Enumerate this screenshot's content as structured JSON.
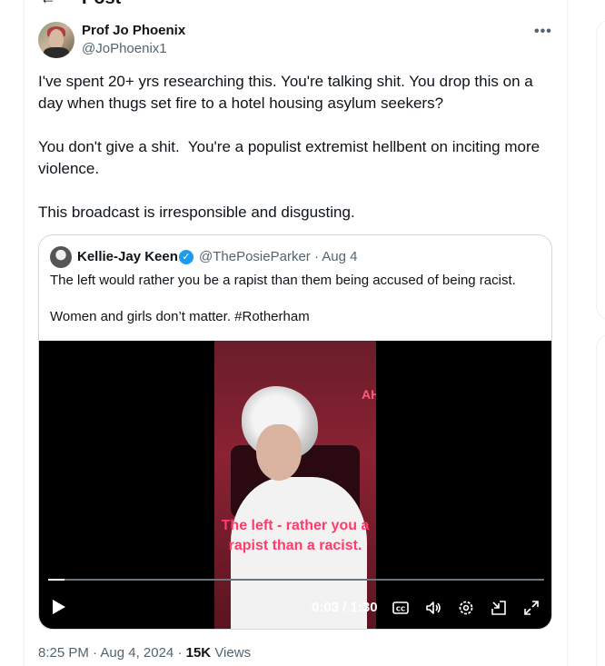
{
  "header": {
    "title": "Post"
  },
  "post": {
    "author_name": "Prof Jo Phoenix",
    "author_handle": "@JoPhoenix1",
    "paragraphs": [
      "I've spent 20+ yrs researching this. You're talking shit. You drop this on a day when thugs set fire to a hotel housing asylum seekers?",
      "You don't give a shit.  You're a populist extremist hellbent on inciting more violence.",
      "This broadcast is irresponsible and disgusting."
    ],
    "timestamp": "8:25 PM · Aug 4, 2024",
    "dot": " · ",
    "views_count": "15K",
    "views_label": " Views"
  },
  "quote": {
    "author_name": "Kellie-Jay Keen",
    "author_handle": "@ThePosieParker · Aug 4",
    "paragraphs": [
      "The left would rather you be a rapist than them being accused of being racist.",
      "Women and girls don’t matter.  #Rotherham"
    ],
    "video": {
      "neon_text": "AHF",
      "caption_line1": "The left - rather you a",
      "caption_line2": "rapist than a racist.",
      "time_display": "0:03 / 1:30",
      "progress": 0.033
    }
  },
  "colors": {
    "text_primary": "#0f1419",
    "text_secondary": "#536471",
    "verified_blue": "#1d9bf0",
    "caption_pink": "#ff3b6b"
  },
  "icons": {
    "back": "back-arrow-icon",
    "more": "more-icon",
    "verified": "verified-badge-icon",
    "play": "play-icon",
    "captions": "captions-icon",
    "volume": "volume-icon",
    "settings": "settings-icon",
    "minimize": "minimize-icon",
    "fullscreen": "fullscreen-icon"
  }
}
